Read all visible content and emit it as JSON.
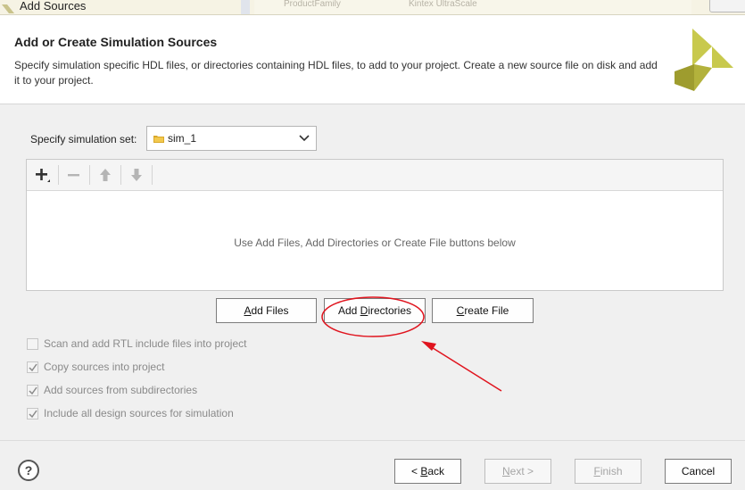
{
  "window": {
    "title": "Add Sources",
    "background_text": [
      "ProductFamily",
      "Kintex UltraScale"
    ]
  },
  "header": {
    "title": "Add or Create Simulation Sources",
    "description": "Specify simulation specific HDL files, or directories containing HDL files, to add to your project. Create a new source file on disk and add it to your project."
  },
  "simulation_set": {
    "label": "Specify simulation set:",
    "selected": "sim_1"
  },
  "sources_table": {
    "toolbar": [
      "add-icon",
      "remove-icon",
      "move-up-icon",
      "move-down-icon"
    ],
    "empty_message": "Use Add Files, Add Directories or Create File buttons below"
  },
  "action_buttons": {
    "add_files": {
      "mnemonic": "A",
      "rest": "dd Files"
    },
    "add_directories": {
      "prefix": "Add ",
      "mnemonic": "D",
      "rest": "irectories"
    },
    "create_file": {
      "mnemonic": "C",
      "rest": "reate File"
    }
  },
  "options": [
    {
      "id": "scan_rtl",
      "label": "Scan and add RTL include files into project",
      "checked": false,
      "enabled": false
    },
    {
      "id": "copy_sources",
      "label": "Copy sources into project",
      "checked": true,
      "enabled": false
    },
    {
      "id": "add_subdirs",
      "label": "Add sources from subdirectories",
      "checked": true,
      "enabled": false
    },
    {
      "id": "include_design",
      "label": "Include all design sources for simulation",
      "checked": true,
      "enabled": false
    }
  ],
  "footer": {
    "help": "?",
    "back": {
      "prefix": "< ",
      "mnemonic": "B",
      "rest": "ack"
    },
    "next": {
      "mnemonic": "N",
      "rest": "ext >"
    },
    "finish": {
      "mnemonic": "F",
      "rest": "inish"
    },
    "cancel": "Cancel"
  },
  "annotation": {
    "color": "#e0141e",
    "target": "add_directories"
  }
}
